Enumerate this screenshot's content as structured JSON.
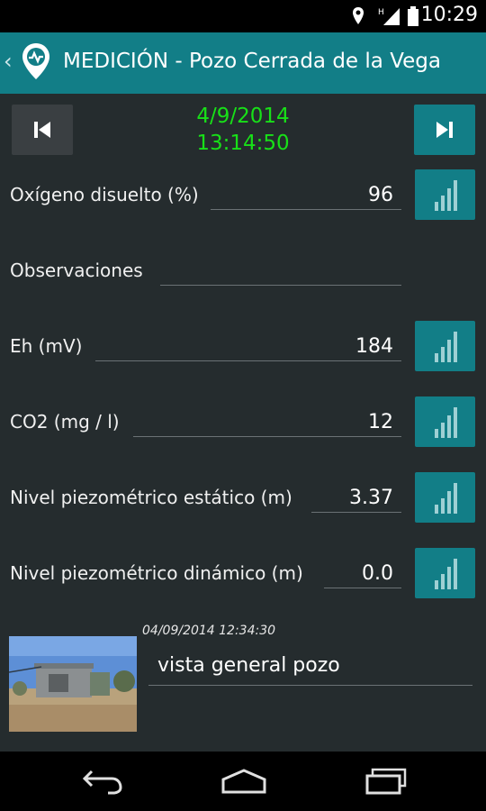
{
  "status_bar": {
    "time": "10:29",
    "icons": [
      "location-icon",
      "signal-icon",
      "battery-icon"
    ]
  },
  "action_bar": {
    "title": "MEDICIÓN - Pozo Cerrada de la Vega",
    "logo_icon": "location-pin-wave-icon",
    "up_icon": "chevron-left-icon"
  },
  "record": {
    "date": "4/9/2014",
    "time": "13:14:50",
    "prev_icon": "skip-previous-icon",
    "next_icon": "skip-next-icon"
  },
  "measurements": [
    {
      "label": "Oxígeno disuelto (%)",
      "value": "96",
      "has_chart": true
    },
    {
      "label": "Observaciones",
      "value": "",
      "has_chart": false
    },
    {
      "label": "Eh (mV)",
      "value": "184",
      "has_chart": true
    },
    {
      "label": "CO2 (mg / l)",
      "value": "12",
      "has_chart": true
    },
    {
      "label": "Nivel piezométrico estático (m)",
      "value": "3.37",
      "has_chart": true
    },
    {
      "label": "Nivel piezométrico dinámico (m)",
      "value": "0.0",
      "has_chart": true
    }
  ],
  "photo": {
    "timestamp": "04/09/2014 12:34:30",
    "caption": "vista general pozo"
  },
  "nav_bar": {
    "icons": [
      "back-icon",
      "home-icon",
      "recents-icon"
    ]
  },
  "colors": {
    "accent": "#127e87",
    "background": "#252c2e",
    "datetime_green": "#18e018"
  }
}
